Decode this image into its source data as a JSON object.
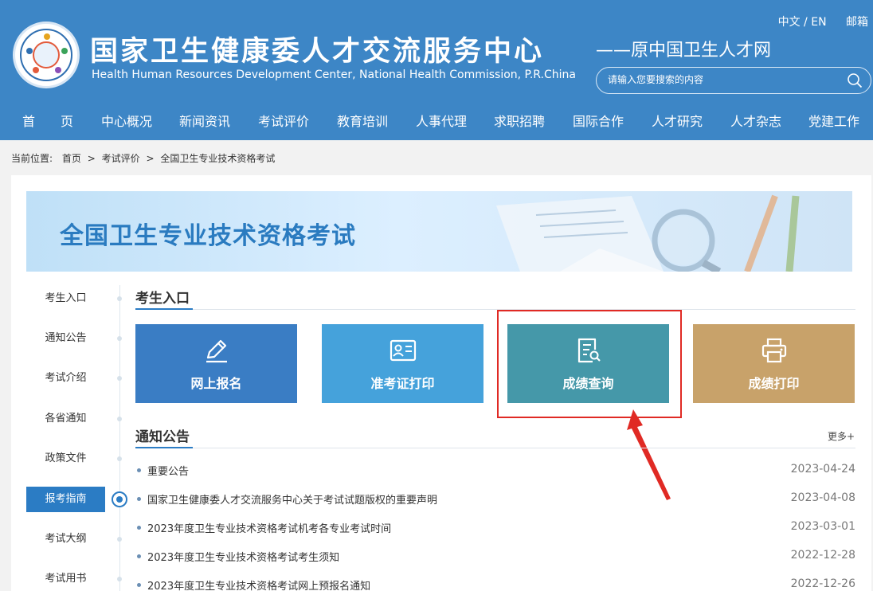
{
  "header": {
    "title": "国家卫生健康委人才交流服务中心",
    "subtitle": "Health Human Resources Development Center, National Health Commission, P.R.China",
    "slogan": "——原中国卫生人才网",
    "language_link": "中文 / EN",
    "mail_link": "邮箱",
    "search_placeholder": "请输入您要搜索的内容",
    "logo_icon": "emblem-logo-icon",
    "search_icon": "search-icon"
  },
  "nav": {
    "items": [
      "首　　页",
      "中心概况",
      "新闻资讯",
      "考试评价",
      "教育培训",
      "人事代理",
      "求职招聘",
      "国际合作",
      "人才研究",
      "人才杂志",
      "党建工作"
    ]
  },
  "breadcrumb": {
    "label": "当前位置:",
    "items": [
      "首页",
      "考试评价",
      "全国卫生专业技术资格考试"
    ],
    "separator": ">"
  },
  "banner": {
    "title": "全国卫生专业技术资格考试"
  },
  "sidebar": {
    "items": [
      "考生入口",
      "通知公告",
      "考试介绍",
      "各省通知",
      "政策文件",
      "报考指南",
      "考试大纲",
      "考试用书"
    ],
    "active_index": 5
  },
  "entrance": {
    "title": "考生入口",
    "tiles": [
      {
        "label": "网上报名",
        "icon": "pen-icon",
        "color": "#3a7dc4"
      },
      {
        "label": "准考证打印",
        "icon": "id-card-icon",
        "color": "#45a2db"
      },
      {
        "label": "成绩查询",
        "icon": "document-search-icon",
        "color": "#4598a9"
      },
      {
        "label": "成绩打印",
        "icon": "printer-icon",
        "color": "#c8a26a"
      }
    ],
    "highlight_color": "#e02a24"
  },
  "notices": {
    "title": "通知公告",
    "more": "更多+",
    "items": [
      {
        "title": "重要公告",
        "date": "2023-04-24"
      },
      {
        "title": "国家卫生健康委人才交流服务中心关于考试试题版权的重要声明",
        "date": "2023-04-08"
      },
      {
        "title": "2023年度卫生专业技术资格考试机考各专业考试时间",
        "date": "2023-03-01"
      },
      {
        "title": "2023年度卫生专业技术资格考试考生须知",
        "date": "2022-12-28"
      },
      {
        "title": "2023年度卫生专业技术资格考试网上预报名通知",
        "date": "2022-12-26"
      }
    ]
  },
  "colors": {
    "header_blue": "#3d86c6",
    "accent_blue": "#2b7cc4"
  }
}
